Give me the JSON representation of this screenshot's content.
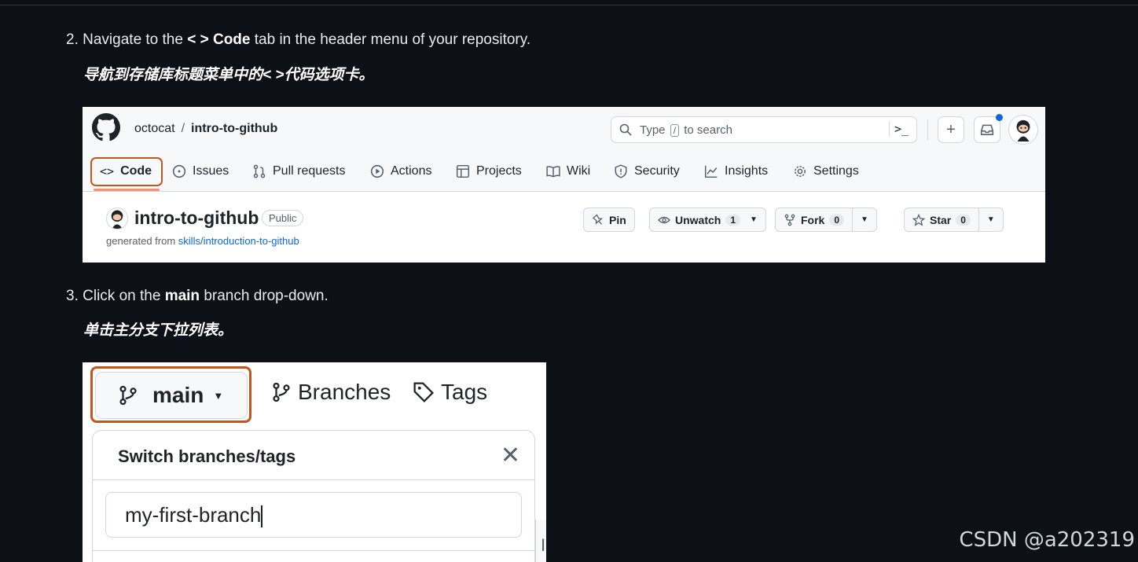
{
  "step2": {
    "num": "2.",
    "pre": "Navigate to the ",
    "bold": "< > Code",
    "post": " tab in the header menu of your repository."
  },
  "step2_zh": {
    "pre": "导航到存储库标题菜单中的< >",
    "bold": "代码",
    "post": "选项卡。"
  },
  "step3": {
    "num": "3.",
    "pre": "Click on the ",
    "bold": "main",
    "post": " branch drop-down."
  },
  "step3_zh": {
    "pre": "单击",
    "bold": "主",
    "post": "分支下拉列表。"
  },
  "github": {
    "owner": "octocat",
    "separator": "/",
    "repo": "intro-to-github",
    "search_pre": "Type",
    "search_key": "/",
    "search_post": "to search",
    "cmd_glyph": ">_",
    "plus_glyph": "+",
    "tabs": [
      {
        "label": "Code",
        "icon": "code-icon"
      },
      {
        "label": "Issues",
        "icon": "issue-icon"
      },
      {
        "label": "Pull requests",
        "icon": "pull-request-icon"
      },
      {
        "label": "Actions",
        "icon": "play-icon"
      },
      {
        "label": "Projects",
        "icon": "table-icon"
      },
      {
        "label": "Wiki",
        "icon": "book-icon"
      },
      {
        "label": "Security",
        "icon": "shield-icon"
      },
      {
        "label": "Insights",
        "icon": "graph-icon"
      },
      {
        "label": "Settings",
        "icon": "gear-icon"
      }
    ],
    "repo_title": "intro-to-github",
    "visibility": "Public",
    "generated_prefix": "generated from",
    "generated_link": "skills/introduction-to-github",
    "pin": "Pin",
    "unwatch": "Unwatch",
    "unwatch_count": "1",
    "fork": "Fork",
    "fork_count": "0",
    "star": "Star",
    "star_count": "0"
  },
  "branch": {
    "main": "main",
    "branches": "Branches",
    "tags": "Tags",
    "panel_title": "Switch branches/tags",
    "filter_value": "my-first-branch",
    "close_glyph": "✕",
    "partial_text": "I"
  },
  "accent": {
    "highlight": "#c2561b",
    "link": "#0969da",
    "tab_underline": "#fd8c73"
  },
  "watermark": "CSDN @a202319"
}
